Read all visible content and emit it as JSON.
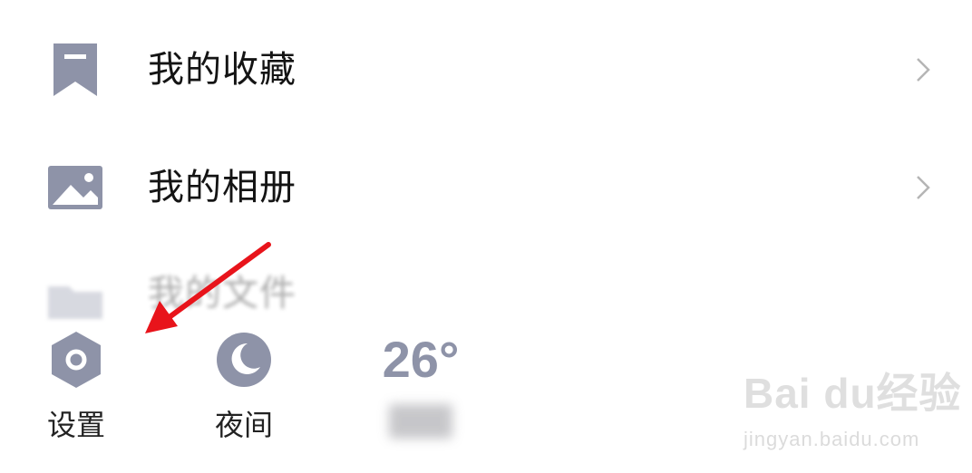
{
  "menu": {
    "items": [
      {
        "label": "我的收藏",
        "icon": "bookmark-icon"
      },
      {
        "label": "我的相册",
        "icon": "image-icon"
      },
      {
        "label": "我的文件",
        "icon": "folder-icon"
      }
    ]
  },
  "bottom_bar": {
    "settings": {
      "label": "设置",
      "icon": "gear-hexagon-icon"
    },
    "night": {
      "label": "夜间",
      "icon": "moon-icon"
    },
    "weather": {
      "temperature": "26°"
    }
  },
  "watermark": {
    "logo": "Bai du经验",
    "url": "jingyan.baidu.com"
  },
  "colors": {
    "icon_gray": "#8e93a8",
    "text": "#141414",
    "arrow": "#e8141b",
    "chevron": "#b5b5b5"
  }
}
